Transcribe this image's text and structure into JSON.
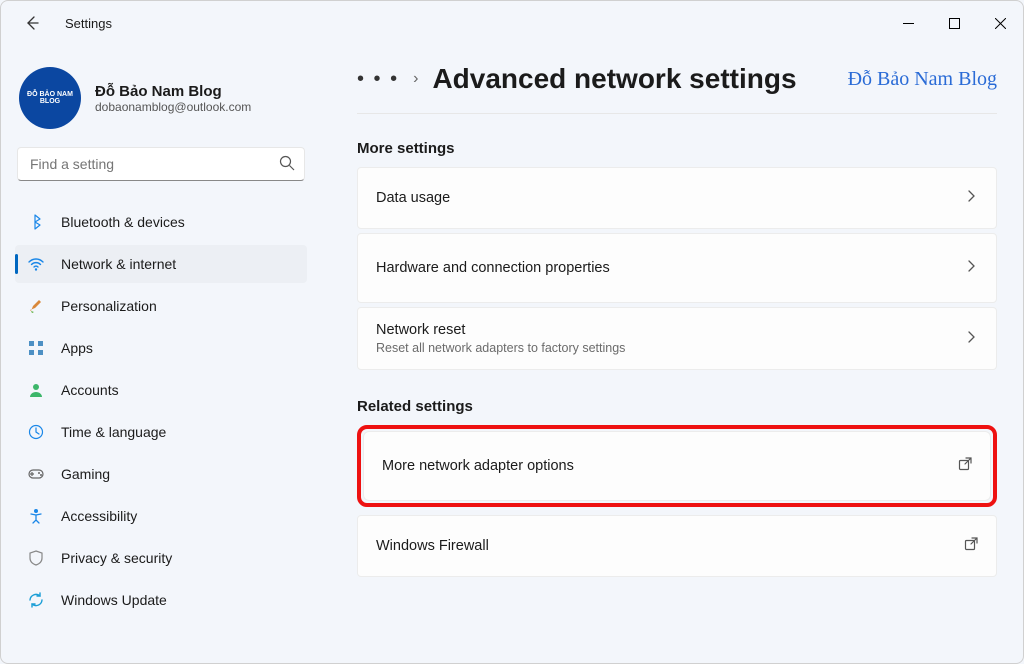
{
  "window": {
    "title": "Settings"
  },
  "profile": {
    "name": "Đỗ Bảo Nam Blog",
    "email": "dobaonamblog@outlook.com",
    "avatar_text": "ĐỖ BẢO NAM BLOG"
  },
  "search": {
    "placeholder": "Find a setting"
  },
  "sidebar": {
    "items": [
      {
        "label": "Bluetooth & devices",
        "icon": "bt"
      },
      {
        "label": "Network & internet",
        "icon": "net",
        "selected": true
      },
      {
        "label": "Personalization",
        "icon": "pen"
      },
      {
        "label": "Apps",
        "icon": "apps"
      },
      {
        "label": "Accounts",
        "icon": "acc"
      },
      {
        "label": "Time & language",
        "icon": "time"
      },
      {
        "label": "Gaming",
        "icon": "game"
      },
      {
        "label": "Accessibility",
        "icon": "accs"
      },
      {
        "label": "Privacy & security",
        "icon": "sec"
      },
      {
        "label": "Windows Update",
        "icon": "upd"
      }
    ]
  },
  "breadcrumb": {
    "dots": "• • •",
    "sep": "›",
    "title": "Advanced network settings"
  },
  "watermark": "Đỗ Bảo Nam Blog",
  "sections": {
    "more_settings": {
      "label": "More settings",
      "items": [
        {
          "title": "Data usage"
        },
        {
          "title": "Hardware and connection properties"
        },
        {
          "title": "Network reset",
          "subtitle": "Reset all network adapters to factory settings"
        }
      ]
    },
    "related_settings": {
      "label": "Related settings",
      "items": [
        {
          "title": "More network adapter options",
          "highlighted": true
        },
        {
          "title": "Windows Firewall"
        }
      ]
    }
  }
}
